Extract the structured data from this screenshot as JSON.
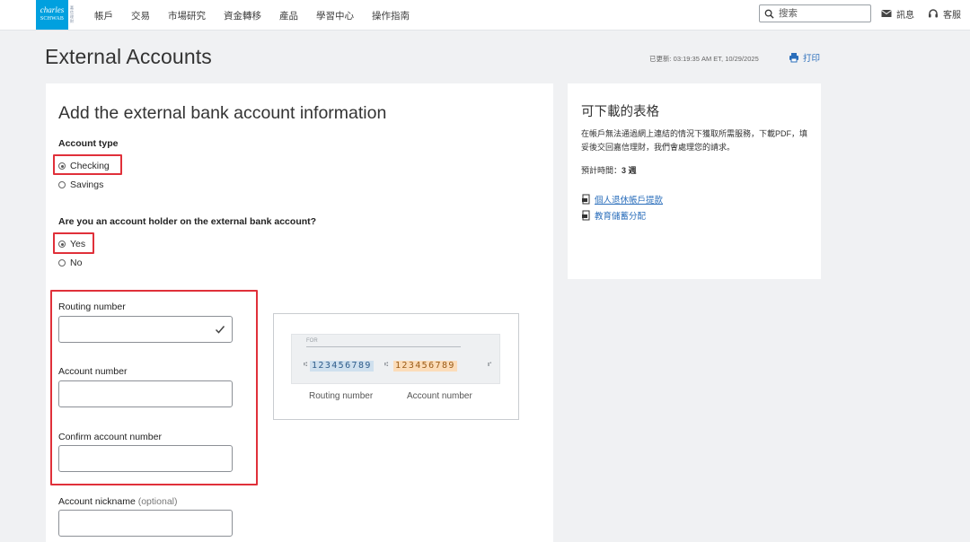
{
  "brand": {
    "line1": "charles",
    "line2": "SCHWAB",
    "tagline": "嘉信理財"
  },
  "nav": {
    "items": [
      "帳戶",
      "交易",
      "市場研究",
      "資金轉移",
      "產品",
      "學習中心",
      "操作指南"
    ]
  },
  "search": {
    "placeholder": "搜索"
  },
  "utilities": {
    "messages": "訊息",
    "support": "客服"
  },
  "page": {
    "title": "External Accounts",
    "updated": "已更新: 03:19:35 AM ET, 10/29/2025",
    "print": "打印"
  },
  "form": {
    "heading": "Add the external bank account information",
    "account_type": {
      "label": "Account type",
      "options": [
        "Checking",
        "Savings"
      ],
      "selected": "Checking"
    },
    "holder": {
      "label": "Are you an account holder on the external bank account?",
      "options": [
        "Yes",
        "No"
      ],
      "selected": "Yes"
    },
    "routing": {
      "label": "Routing number",
      "value": ""
    },
    "account": {
      "label": "Account number",
      "value": ""
    },
    "confirm": {
      "label": "Confirm account number",
      "value": ""
    },
    "nickname": {
      "label": "Account nickname",
      "optional": "(optional)",
      "value": ""
    }
  },
  "check": {
    "for_label": "FOR",
    "routing_digits": "123456789",
    "account_digits": "123456789",
    "routing_caption": "Routing number",
    "account_caption": "Account number"
  },
  "side": {
    "title": "可下載的表格",
    "description": "在帳戶無法通過網上連結的情況下獲取所需服務，下載PDF，填妥後交回嘉信理財，我們會處理您的請求。",
    "eta_label": "預計時間：",
    "eta_value": "3 週",
    "links": [
      "個人退休帳戶提款",
      "教育儲蓄分配"
    ]
  },
  "colors": {
    "accent_blue": "#00a0df",
    "link_blue": "#2a6ebb",
    "highlight_red": "#e0303a"
  }
}
